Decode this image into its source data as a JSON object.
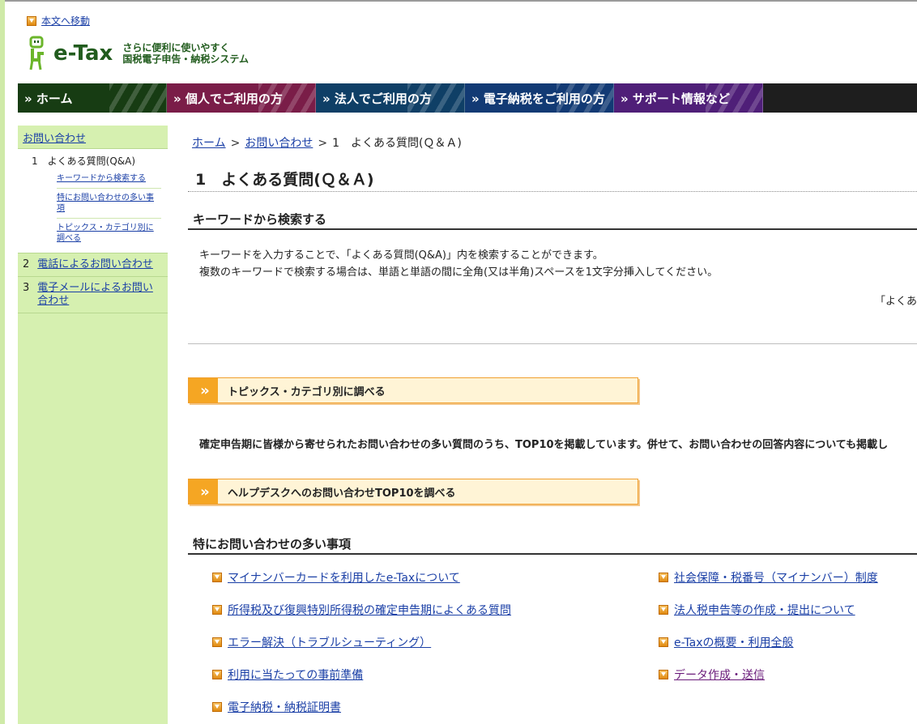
{
  "skip_link": "本文へ移動",
  "logo": {
    "name": "e-Tax",
    "tagline_line1": "さらに便利に使いやすく",
    "tagline_line2": "国税電子申告・納税システム"
  },
  "nav": [
    {
      "label": "» ホーム"
    },
    {
      "label": "» 個人でご利用の方"
    },
    {
      "label": "» 法人でご利用の方"
    },
    {
      "label": "» 電子納税をご利用の方"
    },
    {
      "label": "» サポート情報など"
    }
  ],
  "sidebar": {
    "top": "お問い合わせ",
    "current": "1　よくある質問(Q&A)",
    "children": [
      "キーワードから検索する",
      "特にお問い合わせの多い事項",
      "トピックス・カテゴリ別に調べる"
    ],
    "items": [
      {
        "num": "2",
        "label": "電話によるお問い合わせ"
      },
      {
        "num": "3",
        "label": "電子メールによるお問い合わせ"
      }
    ]
  },
  "breadcrumb": {
    "home": "ホーム",
    "sep": ">",
    "contact": "お問い合わせ",
    "current": "1　よくある質問(Ｑ＆Ａ)"
  },
  "page_title": "1　よくある質問(Ｑ＆Ａ)",
  "keyword_section": {
    "heading": "キーワードから検索する",
    "line1": "キーワードを入力することで、「よくある質問(Q&A)」内を検索することができます。",
    "line2": "複数のキーワードで検索する場合は、単語と単語の間に全角(又は半角)スペースを1文字分挿入してください。",
    "note": "「よくある"
  },
  "topics_button": {
    "arrow": "»",
    "label": "トピックス・カテゴリ別に調べる"
  },
  "top10_desc": "確定申告期に皆様から寄せられたお問い合わせの多い質問のうち、TOP10を掲載しています。併せて、お問い合わせの回答内容についても掲載し",
  "top10_button": {
    "arrow": "»",
    "label": "ヘルプデスクへのお問い合わせTOP10を調べる"
  },
  "frequent_section": {
    "heading": "特にお問い合わせの多い事項",
    "left": [
      "マイナンバーカードを利用したe-Taxについて",
      "所得税及び復興特別所得税の確定申告期によくある質問",
      "エラー解決（トラブルシューティング）",
      "利用に当たっての事前準備",
      "電子納税・納税証明書"
    ],
    "right": [
      "社会保障・税番号（マイナンバー）制度",
      "法人税申告等の作成・提出について",
      "e-Taxの概要・利用全般",
      "データ作成・送信"
    ]
  },
  "colors": {
    "nav_home": "#173c13",
    "nav_personal": "#7a1d48",
    "nav_corp": "#0f3f66",
    "nav_pay": "#123a74",
    "nav_support": "#4f1f78",
    "sidebar_bg": "#d6f0b0",
    "accent_orange": "#f5a623",
    "link": "#1a3fa6"
  }
}
